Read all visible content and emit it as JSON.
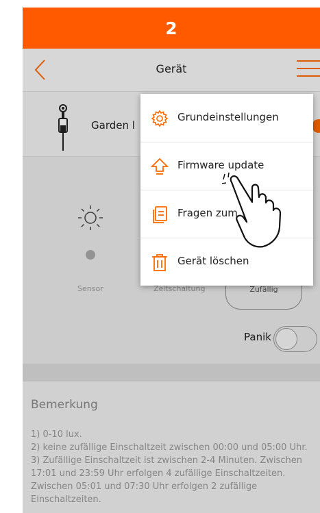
{
  "step": "2",
  "header": {
    "title": "Gerät",
    "back_icon": "chevron-left-icon",
    "menu_icon": "hamburger-icon"
  },
  "device": {
    "name": "Garden l",
    "icon": "garden-stake-icon"
  },
  "modes": {
    "sensor": "Sensor",
    "timer": "Zeitschaltung",
    "random": "Zufällig"
  },
  "panic": {
    "label": "Panik",
    "state": "off"
  },
  "remark": {
    "title": "Bemerkung",
    "text": "1) 0-10 lux.\n2) keine zufällige Einschaltzeit zwischen 00:00 und 05:00 Uhr.\n3) Zufällige Einschaltzeit ist zwischen 2-4 Minuten. Zwischen 17:01 und 23:59 Uhr erfolgen 4 zufällige Einschaltzeiten. Zwischen 05:01 und 07:30 Uhr erfolgen 2 zufällige Einschaltzeiten."
  },
  "menu": {
    "items": [
      {
        "label": "Grundeinstellungen",
        "icon": "gear-icon"
      },
      {
        "label": "Firmware update",
        "icon": "upload-arrow-icon"
      },
      {
        "label": "Fragen zum",
        "icon": "document-icon"
      },
      {
        "label": "Gerät löschen",
        "icon": "trash-icon"
      }
    ]
  },
  "colors": {
    "accent": "#ff5a00",
    "icon_orange": "#ff6a00"
  }
}
